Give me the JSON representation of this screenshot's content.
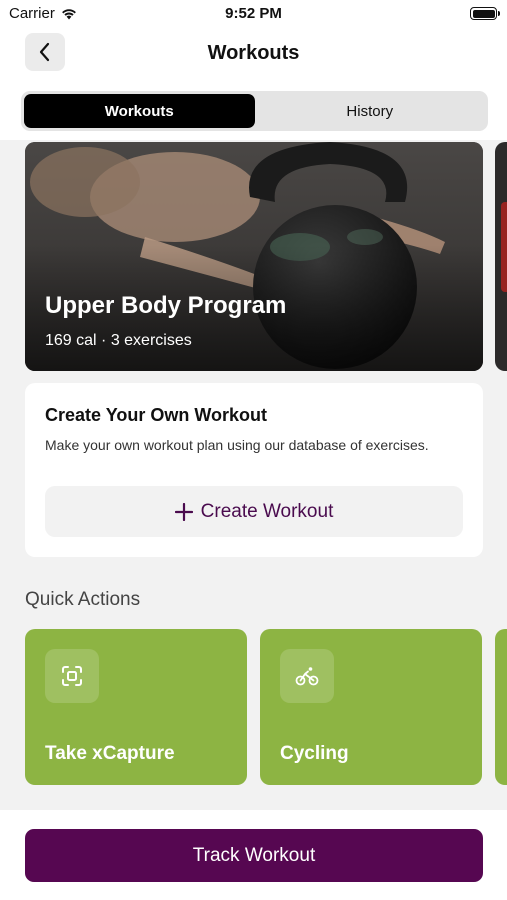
{
  "status_bar": {
    "carrier": "Carrier",
    "time": "9:52 PM",
    "wifi_icon": "wifi-icon",
    "battery_icon": "battery-icon"
  },
  "header": {
    "title": "Workouts",
    "back_icon": "chevron-left-icon"
  },
  "segments": {
    "items": [
      "Workouts",
      "History"
    ],
    "selected": "Workouts"
  },
  "featured_program": {
    "title": "Upper Body Program",
    "meta": "169 cal · 3 exercises"
  },
  "create_workout": {
    "title": "Create Your Own Workout",
    "description": "Make your own workout plan using our database of exercises.",
    "button_icon": "plus-icon",
    "button_label": "Create Workout"
  },
  "quick_actions": {
    "title": "Quick Actions",
    "items": [
      {
        "label": "Take xCapture",
        "icon": "scan-icon"
      },
      {
        "label": "Cycling",
        "icon": "bicycle-icon"
      }
    ]
  },
  "bottom": {
    "primary_button": "Track Workout"
  },
  "colors": {
    "primary": "#560751",
    "quick_action_green": "#8db443",
    "segment_active": "#000000",
    "create_text": "#4a0b4e"
  }
}
